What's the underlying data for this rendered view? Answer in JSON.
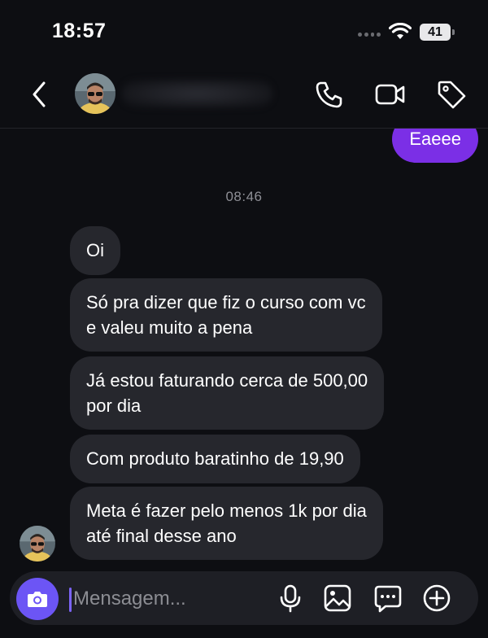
{
  "status_bar": {
    "time": "18:57",
    "battery": "41"
  },
  "header": {
    "contact_name": ""
  },
  "messages": {
    "outgoing": [
      {
        "text": "Eaeee"
      }
    ],
    "timestamp": "08:46",
    "incoming": [
      {
        "lines": [
          "Oi"
        ]
      },
      {
        "lines": [
          "Só pra dizer que fiz o curso com vc",
          "e valeu muito a pena"
        ]
      },
      {
        "lines": [
          "Já estou faturando cerca de 500,00",
          "por dia"
        ]
      },
      {
        "lines": [
          "Com produto baratinho de 19,90"
        ]
      },
      {
        "lines": [
          "Meta é fazer pelo menos 1k por dia",
          "até final desse ano"
        ]
      }
    ]
  },
  "composer": {
    "placeholder": "Mensagem..."
  },
  "colors": {
    "accent": "#7b2fe6",
    "camera": "#6c55f5",
    "bubble_in": "#26272d",
    "background": "#0d0e12"
  },
  "icons": [
    "back-icon",
    "phone-icon",
    "video-icon",
    "tag-icon",
    "camera-icon",
    "microphone-icon",
    "gallery-icon",
    "sticker-icon",
    "plus-icon",
    "wifi-icon"
  ]
}
